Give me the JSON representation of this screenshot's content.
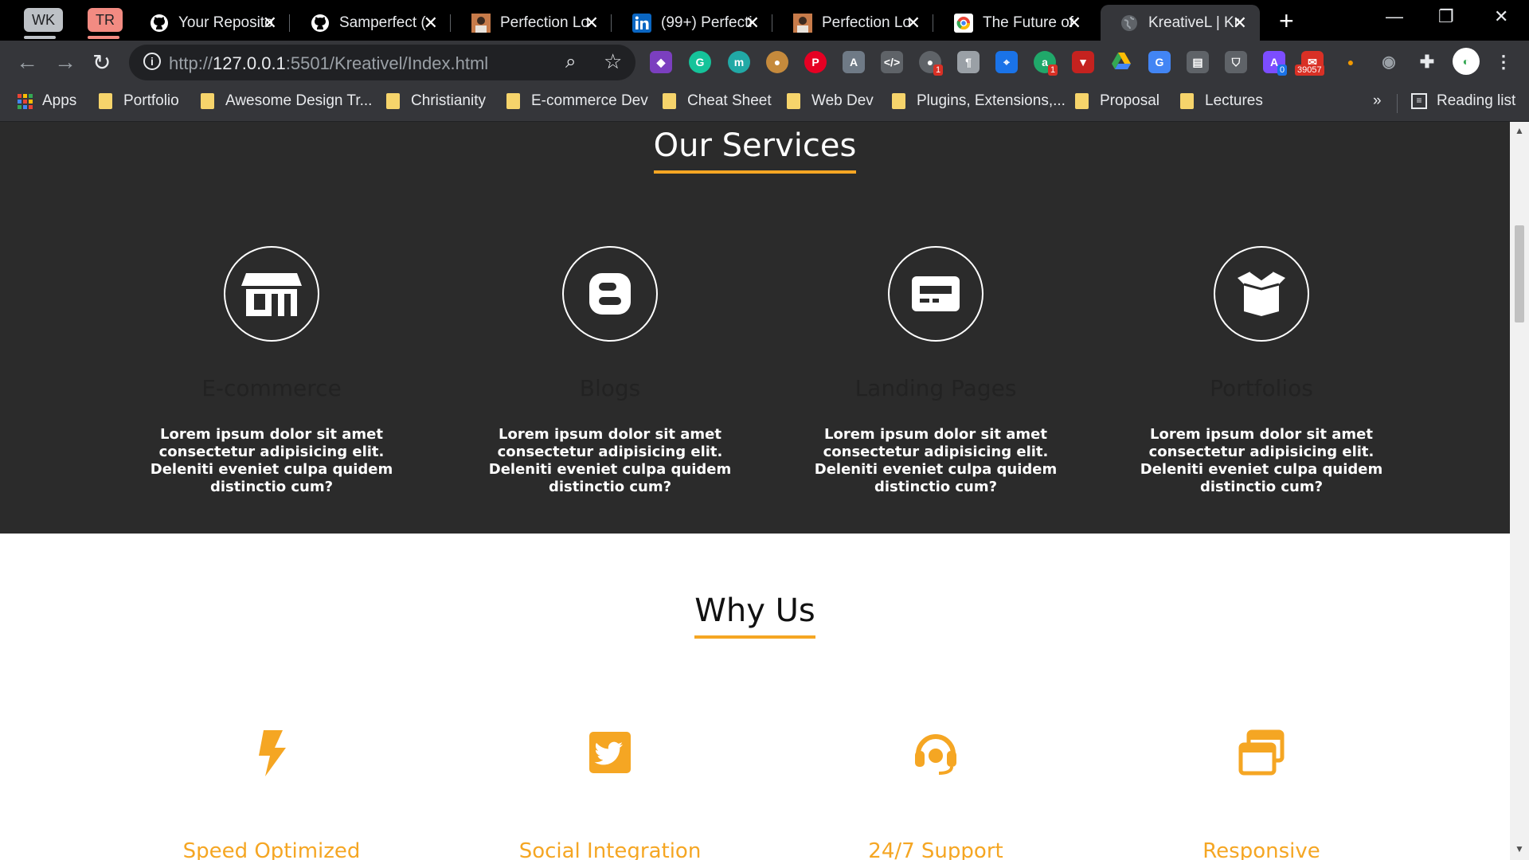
{
  "browser": {
    "tab_groups": [
      {
        "label": "WK",
        "color": "#bdc1c6"
      },
      {
        "label": "TR",
        "color": "#f28b82"
      }
    ],
    "tabs": [
      {
        "title": "Your Reposito",
        "icon": "github-icon"
      },
      {
        "title": "Samperfect (",
        "icon": "github-icon"
      },
      {
        "title": "Perfection Lo",
        "icon": "site-avatar-icon"
      },
      {
        "title": "(99+) Perfecti",
        "icon": "linkedin-icon"
      },
      {
        "title": "Perfection Lo",
        "icon": "site-avatar-icon"
      },
      {
        "title": "The Future of",
        "icon": "chrome-icon"
      },
      {
        "title": "KreativeL | Kr",
        "icon": "globe-icon",
        "active": true
      }
    ],
    "new_tab_label": "+",
    "address": {
      "url_host": "127.0.0.1",
      "url_prefix": "http://",
      "url_suffix": ":5501/Kreativel/Index.html"
    },
    "extension_badges": {
      "badge_a": "1",
      "badge_b": "1",
      "badge_c": "0",
      "badge_mail": "39057"
    },
    "bookmarks": [
      {
        "label": "Apps",
        "type": "apps"
      },
      {
        "label": "Portfolio",
        "type": "folder"
      },
      {
        "label": "Awesome Design Tr...",
        "type": "folder"
      },
      {
        "label": "Christianity",
        "type": "folder"
      },
      {
        "label": "E-commerce Dev",
        "type": "folder"
      },
      {
        "label": "Cheat Sheet",
        "type": "folder"
      },
      {
        "label": "Web Dev",
        "type": "folder"
      },
      {
        "label": "Plugins, Extensions,...",
        "type": "folder"
      },
      {
        "label": "Proposal",
        "type": "folder"
      },
      {
        "label": "Lectures",
        "type": "folder"
      }
    ],
    "bookmarks_overflow": "»",
    "reading_list": "Reading list"
  },
  "page": {
    "services": {
      "title": "Our Services",
      "items": [
        {
          "title": "E-commerce",
          "icon": "store-icon",
          "text": "Lorem ipsum dolor sit amet consectetur adipisicing elit. Deleniti eveniet culpa quidem distinctio cum?"
        },
        {
          "title": "Blogs",
          "icon": "blogger-icon",
          "text": "Lorem ipsum dolor sit amet consectetur adipisicing elit. Deleniti eveniet culpa quidem distinctio cum?"
        },
        {
          "title": "Landing Pages",
          "icon": "landing-page-icon",
          "text": "Lorem ipsum dolor sit amet consectetur adipisicing elit. Deleniti eveniet culpa quidem distinctio cum?"
        },
        {
          "title": "Portfolios",
          "icon": "open-box-icon",
          "text": "Lorem ipsum dolor sit amet consectetur adipisicing elit. Deleniti eveniet culpa quidem distinctio cum?"
        }
      ]
    },
    "why_us": {
      "title": "Why Us",
      "items": [
        {
          "title": "Speed Optimized",
          "icon": "lightning-icon"
        },
        {
          "title": "Social Integration",
          "icon": "twitter-icon"
        },
        {
          "title": "24/7 Support",
          "icon": "headset-icon"
        },
        {
          "title": "Responsive",
          "icon": "windows-icon"
        }
      ]
    },
    "colors": {
      "accent": "#f5a623",
      "dark_section": "#2b2b2b"
    }
  }
}
